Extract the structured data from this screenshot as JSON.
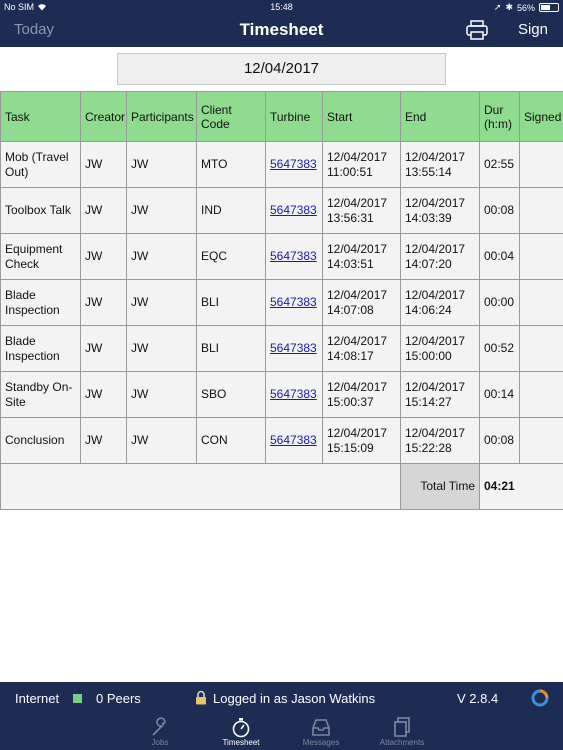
{
  "status_bar": {
    "carrier": "No SIM",
    "time": "15:48",
    "battery": "56%",
    "battery_level": 0.56
  },
  "nav": {
    "today": "Today",
    "title": "Timesheet",
    "sign": "Sign",
    "print_icon": "printer-icon"
  },
  "date": "12/04/2017",
  "table": {
    "headers": {
      "task": "Task",
      "creator": "Creator",
      "participants": "Participants",
      "client_code": "Client Code",
      "turbine": "Turbine",
      "start": "Start",
      "end": "End",
      "dur_1": "Dur",
      "dur_2": "(h:m)",
      "signed": "Signed"
    },
    "rows": [
      {
        "task_1": "Mob (Travel",
        "task_2": "Out)",
        "creator": "JW",
        "participants": "JW",
        "client_code": "MTO",
        "turbine": "5647383",
        "start_date": "12/04/2017",
        "start_time": "11:00:51",
        "end_date": "12/04/2017",
        "end_time": "13:55:14",
        "dur": "02:55",
        "signed": ""
      },
      {
        "task_1": "Toolbox Talk",
        "task_2": "",
        "creator": "JW",
        "participants": "JW",
        "client_code": "IND",
        "turbine": "5647383",
        "start_date": "12/04/2017",
        "start_time": "13:56:31",
        "end_date": "12/04/2017",
        "end_time": "14:03:39",
        "dur": "00:08",
        "signed": ""
      },
      {
        "task_1": "Equipment",
        "task_2": "Check",
        "creator": "JW",
        "participants": "JW",
        "client_code": "EQC",
        "turbine": "5647383",
        "start_date": "12/04/2017",
        "start_time": "14:03:51",
        "end_date": "12/04/2017",
        "end_time": "14:07:20",
        "dur": "00:04",
        "signed": ""
      },
      {
        "task_1": "Blade",
        "task_2": "Inspection",
        "creator": "JW",
        "participants": "JW",
        "client_code": "BLI",
        "turbine": "5647383",
        "start_date": "12/04/2017",
        "start_time": "14:07:08",
        "end_date": "12/04/2017",
        "end_time": "14:06:24",
        "dur": "00:00",
        "signed": ""
      },
      {
        "task_1": "Blade",
        "task_2": "Inspection",
        "creator": "JW",
        "participants": "JW",
        "client_code": "BLI",
        "turbine": "5647383",
        "start_date": "12/04/2017",
        "start_time": "14:08:17",
        "end_date": "12/04/2017",
        "end_time": "15:00:00",
        "dur": "00:52",
        "signed": ""
      },
      {
        "task_1": "Standby On-",
        "task_2": "Site",
        "creator": "JW",
        "participants": "JW",
        "client_code": "SBO",
        "turbine": "5647383",
        "start_date": "12/04/2017",
        "start_time": "15:00:37",
        "end_date": "12/04/2017",
        "end_time": "15:14:27",
        "dur": "00:14",
        "signed": ""
      },
      {
        "task_1": "Conclusion",
        "task_2": "",
        "creator": "JW",
        "participants": "JW",
        "client_code": "CON",
        "turbine": "5647383",
        "start_date": "12/04/2017",
        "start_time": "15:15:09",
        "end_date": "12/04/2017",
        "end_time": "15:22:28",
        "dur": "00:08",
        "signed": ""
      }
    ],
    "total_label": "Total Time",
    "total_value": "04:21"
  },
  "info_bar": {
    "internet": "Internet",
    "internet_status_color": "#74d183",
    "peers": "0 Peers",
    "logged_in": "Logged in as Jason Watkins",
    "version": "V 2.8.4"
  },
  "tabs": [
    {
      "label": "Jobs",
      "icon": "wrench-icon",
      "active": false
    },
    {
      "label": "Timesheet",
      "icon": "stopwatch-icon",
      "active": true
    },
    {
      "label": "Messages",
      "icon": "inbox-icon",
      "active": false
    },
    {
      "label": "Attachments",
      "icon": "documents-icon",
      "active": false
    }
  ],
  "colors": {
    "navy": "#1c2c52",
    "header_green": "#8fdb8f",
    "row_bg": "#f3f3f3",
    "link": "#1a1aa6"
  }
}
